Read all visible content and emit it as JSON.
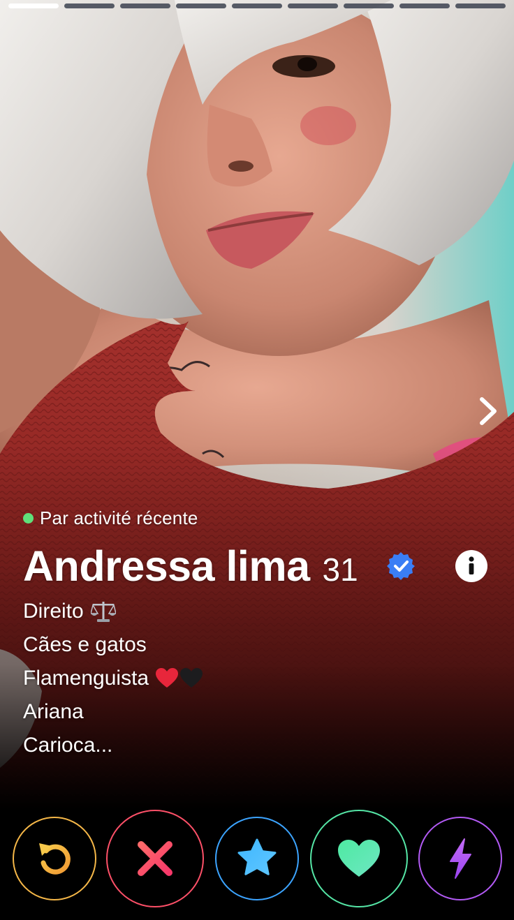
{
  "profile": {
    "activity": "Par activité récente",
    "name": "Andressa lima",
    "age": "31",
    "verified": true,
    "photo_index": 1,
    "photo_count": 9,
    "bio": [
      {
        "text": "Direito",
        "emoji": "scales-emoji"
      },
      {
        "text": "Cães e gatos",
        "emoji": ""
      },
      {
        "text": "Flamenguista",
        "emoji": "red-heart-black-heart-emoji"
      },
      {
        "text": "Ariana",
        "emoji": ""
      },
      {
        "text": "Carioca...",
        "emoji": ""
      }
    ]
  },
  "icons": {
    "next": "chevron-right-icon",
    "info": "info-icon",
    "verified": "verified-badge-icon",
    "rewind": "rewind-icon",
    "nope": "x-icon",
    "super_like": "star-icon",
    "like": "heart-icon",
    "boost": "lightning-icon"
  },
  "colors": {
    "rewind": "#f5b748",
    "nope": "#fd5068",
    "super_like": "#3ca4ff",
    "like": "#55e6a6",
    "boost": "#b25af4",
    "online_dot": "#5fe07a",
    "verified": "#3a7ef5"
  }
}
